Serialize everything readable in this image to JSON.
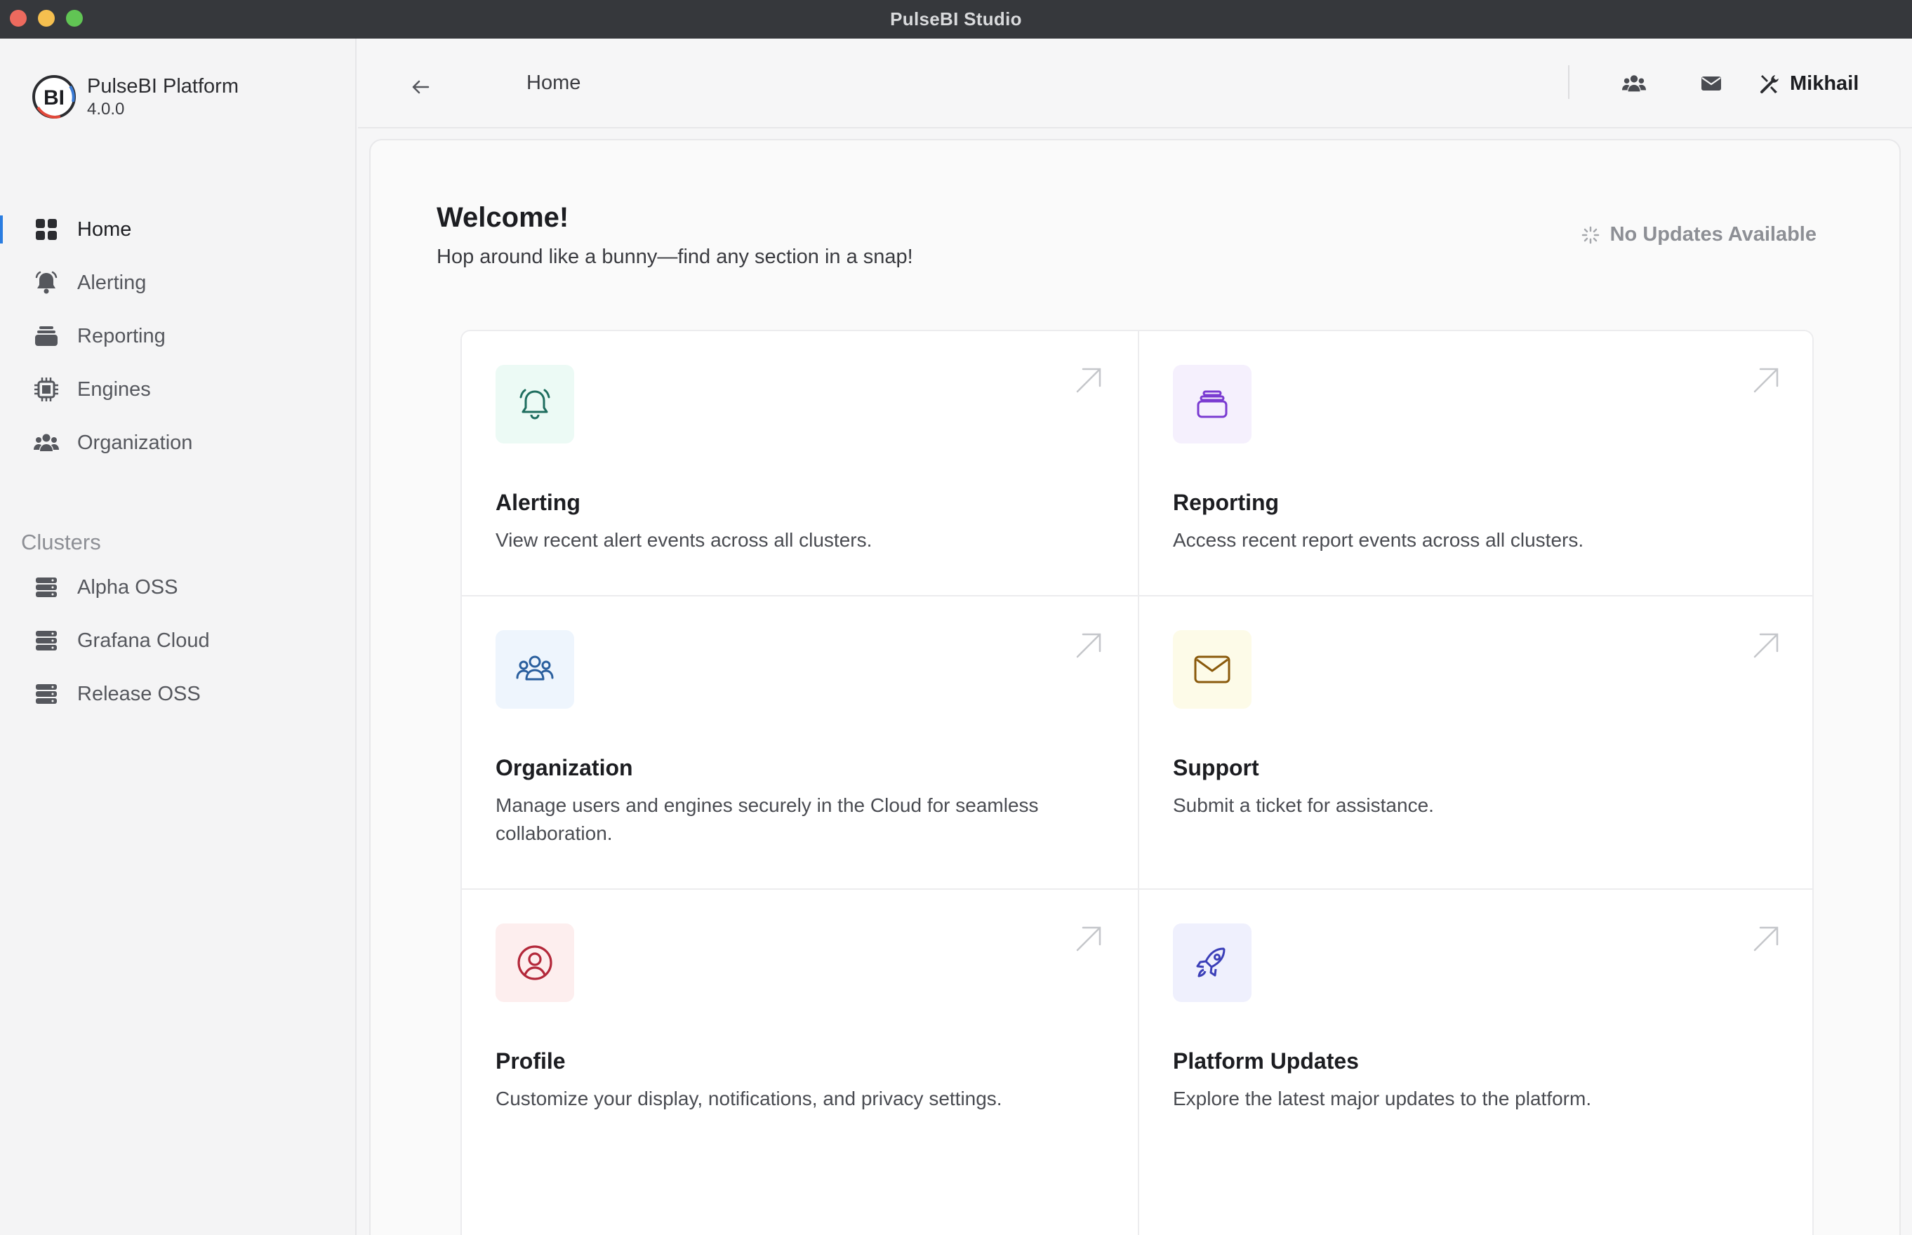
{
  "window": {
    "title": "PulseBI Studio"
  },
  "brand": {
    "name": "PulseBI Platform",
    "version": "4.0.0",
    "logo_text": "BI"
  },
  "nav": [
    {
      "label": "Home",
      "icon": "grid-icon",
      "active": true
    },
    {
      "label": "Alerting",
      "icon": "bell-icon"
    },
    {
      "label": "Reporting",
      "icon": "archive-icon"
    },
    {
      "label": "Engines",
      "icon": "chip-icon"
    },
    {
      "label": "Organization",
      "icon": "users-icon"
    }
  ],
  "clusters": {
    "label": "Clusters",
    "items": [
      {
        "label": "Alpha OSS",
        "icon": "server-icon"
      },
      {
        "label": "Grafana Cloud",
        "icon": "server-icon"
      },
      {
        "label": "Release OSS",
        "icon": "server-icon"
      }
    ]
  },
  "header": {
    "breadcrumb": "Home",
    "user_name": "Mikhail",
    "icons": [
      "users-icon",
      "mail-icon",
      "tools-icon"
    ]
  },
  "main": {
    "welcome_title": "Welcome!",
    "welcome_subtitle": "Hop around like a bunny—find any section in a snap!",
    "updates_status": "No Updates Available",
    "cards": [
      {
        "title": "Alerting",
        "description": "View recent alert events across all clusters.",
        "icon": "bell-icon",
        "tint": "#ecfaf5",
        "color": "#1f6e5f"
      },
      {
        "title": "Reporting",
        "description": "Access recent report events across all clusters.",
        "icon": "archive-icon",
        "tint": "#f5f0fd",
        "color": "#7a3bd1"
      },
      {
        "title": "Organization",
        "description": "Manage users and engines securely in the Cloud for seamless collaboration.",
        "icon": "users-icon",
        "tint": "#eef5fd",
        "color": "#2a5f9e"
      },
      {
        "title": "Support",
        "description": "Submit a ticket for assistance.",
        "icon": "mail-icon",
        "tint": "#fdfbe8",
        "color": "#8a5a0c"
      },
      {
        "title": "Profile",
        "description": "Customize your display, notifications, and privacy settings.",
        "icon": "user-circle-icon",
        "tint": "#fdeeee",
        "color": "#b3283a"
      },
      {
        "title": "Platform Updates",
        "description": "Explore the latest major updates to the platform.",
        "icon": "rocket-icon",
        "tint": "#eff0fd",
        "color": "#3b3fb8"
      }
    ]
  }
}
